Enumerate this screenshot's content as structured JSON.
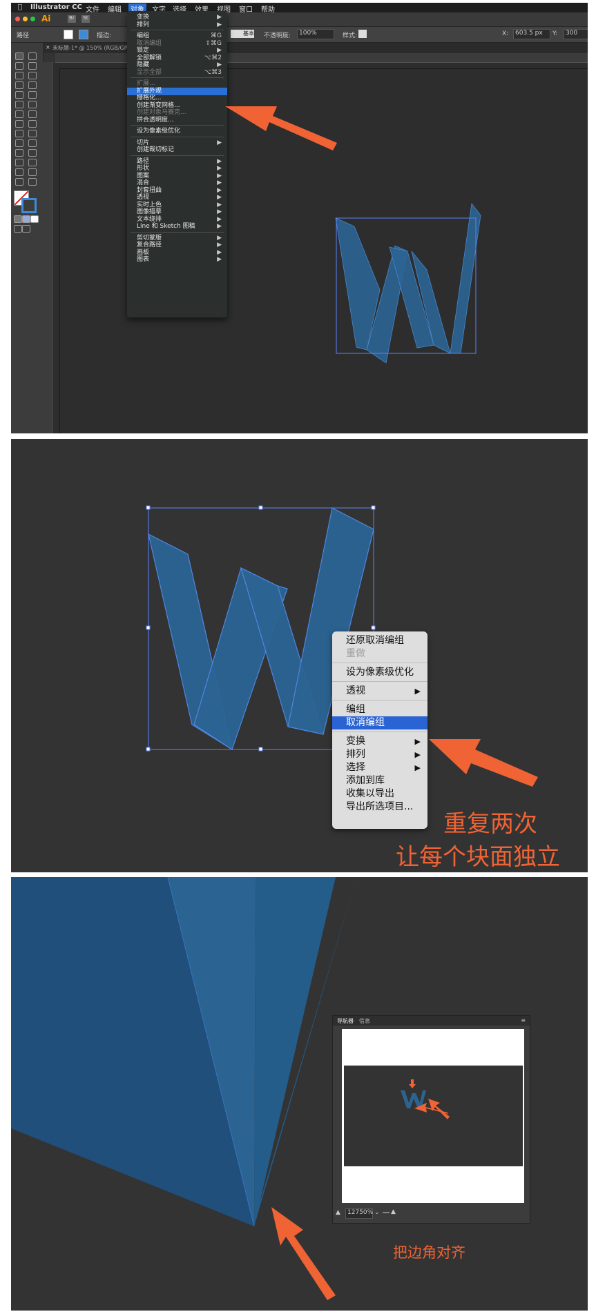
{
  "panel1": {
    "menubar": [
      "Illustrator CC",
      "文件",
      "编辑",
      "对象",
      "文字",
      "选择",
      "效果",
      "视图",
      "窗口",
      "帮助"
    ],
    "app_logo": "Ai",
    "app_buttons": [
      "Br",
      "St"
    ],
    "control_bar": {
      "path_label": "路径",
      "stroke_label": "描边:",
      "basic_label": "基本",
      "opacity_label": "不透明度:",
      "opacity_value": "100%",
      "style_label": "样式:",
      "x_label": "X:",
      "x_value": "603.5 px",
      "y_label": "Y:",
      "y_value": "300"
    },
    "doc_tab": "未标题-1* @ 150% (RGB/GPU 预览)",
    "object_menu": [
      {
        "label": "变换",
        "submenu": true
      },
      {
        "label": "排列",
        "submenu": true
      },
      {
        "sep": true
      },
      {
        "label": "编组",
        "shortcut": "⌘G"
      },
      {
        "label": "取消编组",
        "shortcut": "⇧⌘G",
        "disabled": true
      },
      {
        "label": "锁定",
        "submenu": true
      },
      {
        "label": "全部解锁",
        "shortcut": "⌥⌘2"
      },
      {
        "label": "隐藏",
        "submenu": true
      },
      {
        "label": "显示全部",
        "shortcut": "⌥⌘3",
        "disabled": true
      },
      {
        "sep": true
      },
      {
        "label": "扩展...",
        "disabled": true
      },
      {
        "label": "扩展外观",
        "highlight": true
      },
      {
        "label": "栅格化..."
      },
      {
        "label": "创建渐变网格..."
      },
      {
        "label": "创建对象马赛克...",
        "disabled": true
      },
      {
        "label": "拼合透明度..."
      },
      {
        "sep": true
      },
      {
        "label": "设为像素级优化"
      },
      {
        "sep": true
      },
      {
        "label": "切片",
        "submenu": true
      },
      {
        "label": "创建裁切标记"
      },
      {
        "sep": true
      },
      {
        "label": "路径",
        "submenu": true
      },
      {
        "label": "形状",
        "submenu": true
      },
      {
        "label": "图案",
        "submenu": true
      },
      {
        "label": "混合",
        "submenu": true
      },
      {
        "label": "封套扭曲",
        "submenu": true
      },
      {
        "label": "透视",
        "submenu": true
      },
      {
        "label": "实时上色",
        "submenu": true
      },
      {
        "label": "图像描摹",
        "submenu": true
      },
      {
        "label": "文本绕排",
        "submenu": true
      },
      {
        "label": "Line 和 Sketch 图稿",
        "submenu": true
      },
      {
        "sep": true
      },
      {
        "label": "剪切蒙版",
        "submenu": true
      },
      {
        "label": "复合路径",
        "submenu": true
      },
      {
        "label": "画板",
        "submenu": true
      },
      {
        "label": "图表",
        "submenu": true
      }
    ]
  },
  "panel2": {
    "context_menu": [
      {
        "label": "还原取消编组"
      },
      {
        "label": "重做",
        "disabled": true
      },
      {
        "sep": true
      },
      {
        "label": "设为像素级优化"
      },
      {
        "sep": true
      },
      {
        "label": "透视",
        "submenu": true
      },
      {
        "sep": true
      },
      {
        "label": "编组"
      },
      {
        "label": "取消编组",
        "highlight": true
      },
      {
        "sep": true
      },
      {
        "label": "变换",
        "submenu": true
      },
      {
        "label": "排列",
        "submenu": true
      },
      {
        "label": "选择",
        "submenu": true
      },
      {
        "label": "添加到库"
      },
      {
        "label": "收集以导出"
      },
      {
        "label": "导出所选项目..."
      }
    ],
    "note_line1": "重复两次",
    "note_line2": "让每个块面独立"
  },
  "panel3": {
    "navigator_tabs": [
      "导航器",
      "信息"
    ],
    "zoom_value": "12750%",
    "note": "把边角对齐"
  },
  "colors": {
    "accent_arrow": "#ef6334",
    "menu_highlight": "#2a6fd6",
    "shape_blue": "#2b6493",
    "selection": "#4d7cff",
    "dark_bg": "#333333"
  },
  "icons": [
    "apple-icon",
    "arrow-pointer",
    "submenu-arrow",
    "selection-tool",
    "direct-selection-tool",
    "pen-tool",
    "type-tool",
    "zoom-out-icon",
    "zoom-in-icon"
  ]
}
